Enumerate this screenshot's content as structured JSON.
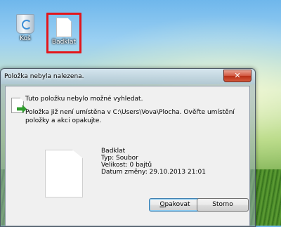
{
  "desktop": {
    "icons": [
      {
        "label": "Koš",
        "icon": "recycle-bin-icon"
      },
      {
        "label": "Badklat",
        "icon": "file-icon"
      }
    ]
  },
  "dialog": {
    "title": "Položka nebyla nalezena.",
    "close_label": "✕",
    "heading": "Tuto položku nebylo možné vyhledat.",
    "detail": "Položka již není umístěna v C:\\Users\\Vova\\Plocha. Ověřte umístění položky a akci opakujte.",
    "item": {
      "name": "Badklat",
      "type": "Typ: Soubor",
      "size": "Velikost: 0 bajtů",
      "date": "Datum změny: 29.10.2013 21:01"
    },
    "buttons": {
      "retry_first": "O",
      "retry_rest": "pakovat",
      "cancel": "Storno"
    }
  },
  "colors": {
    "highlight": "#e3161b",
    "close": "#c9432a"
  }
}
